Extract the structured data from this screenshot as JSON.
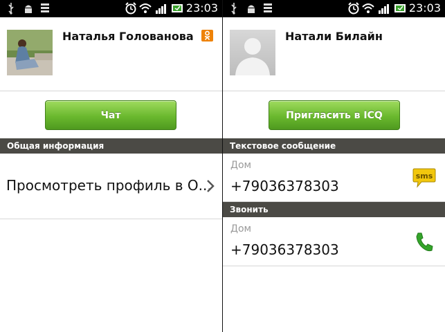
{
  "status": {
    "time": "23:03"
  },
  "left": {
    "contact_name": "Наталья Голованова",
    "chat_button": "Чат",
    "section_general": "Общая информация",
    "profile_link": "Просмотреть профиль в О...",
    "badge_icon": "odnoklassniki-icon",
    "accent": "#ee8208"
  },
  "right": {
    "contact_name": "Натали Билайн",
    "invite_button": "Пригласить в ICQ",
    "section_sms": "Текстовое сообщение",
    "sms_label": "Дом",
    "sms_number": "+79036378303",
    "sms_icon": "sms",
    "section_call": "Звонить",
    "call_label": "Дом",
    "call_number": "+79036378303",
    "call_icon": "phone-icon",
    "button_color": "#6ab82e"
  }
}
